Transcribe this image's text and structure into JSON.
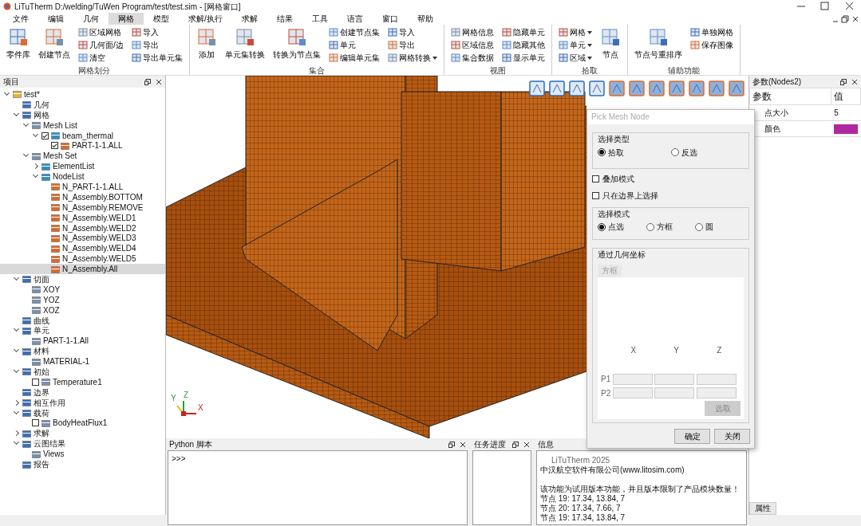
{
  "window": {
    "title": "LiTuTherm D:/welding/TuWen Program/test/test.sim - [网格窗口]"
  },
  "menu": [
    {
      "label": "文件",
      "selected": false
    },
    {
      "label": "编辑",
      "selected": false
    },
    {
      "label": "几何",
      "selected": false
    },
    {
      "label": "网格",
      "selected": true
    },
    {
      "label": "模型",
      "selected": false
    },
    {
      "label": "求解/执行",
      "selected": false
    },
    {
      "label": "求解",
      "selected": false
    },
    {
      "label": "结果",
      "selected": false
    },
    {
      "label": "工具",
      "selected": false
    },
    {
      "label": "语言",
      "selected": false
    },
    {
      "label": "窗口",
      "selected": false
    },
    {
      "label": "帮助",
      "selected": false
    }
  ],
  "ribbon": [
    {
      "label": "网格划分",
      "items": [
        {
          "kind": "large",
          "label": "零件库"
        },
        {
          "kind": "large",
          "label": "创建节点"
        },
        {
          "kind": "column",
          "buttons": [
            {
              "label": "区域网格",
              "dropdown": false
            },
            {
              "label": "几何面/边",
              "dropdown": false
            },
            {
              "label": "清空",
              "dropdown": false
            }
          ]
        },
        {
          "kind": "column",
          "buttons": [
            {
              "label": "导入",
              "dropdown": false
            },
            {
              "label": "导出",
              "dropdown": false
            },
            {
              "label": "导出单元集",
              "dropdown": false
            }
          ]
        }
      ]
    },
    {
      "label": "集合",
      "items": [
        {
          "kind": "large",
          "label": "添加"
        },
        {
          "kind": "large",
          "label": "单元集转换"
        },
        {
          "kind": "large",
          "label": "转换为节点集"
        },
        {
          "kind": "column",
          "buttons": [
            {
              "label": "创建节点集",
              "dropdown": false
            },
            {
              "label": "单元",
              "dropdown": false
            },
            {
              "label": "编辑单元集",
              "dropdown": false
            }
          ]
        },
        {
          "kind": "column",
          "buttons": [
            {
              "label": "导入",
              "dropdown": false
            },
            {
              "label": "导出",
              "dropdown": false
            },
            {
              "label": "网格转换",
              "dropdown": true
            }
          ]
        }
      ]
    },
    {
      "label": "视图",
      "items": [
        {
          "kind": "column",
          "buttons": [
            {
              "label": "网格信息",
              "dropdown": false
            },
            {
              "label": "区域信息",
              "dropdown": false
            },
            {
              "label": "集合数据",
              "dropdown": false
            }
          ]
        },
        {
          "kind": "column",
          "buttons": [
            {
              "label": "隐藏单元",
              "dropdown": false
            },
            {
              "label": "隐藏其他",
              "dropdown": false
            },
            {
              "label": "显示单元",
              "dropdown": false
            }
          ]
        }
      ]
    },
    {
      "label": "拾取",
      "items": [
        {
          "kind": "column",
          "buttons": [
            {
              "label": "网格",
              "dropdown": true
            },
            {
              "label": "单元",
              "dropdown": true
            },
            {
              "label": "区域",
              "dropdown": true
            }
          ]
        },
        {
          "kind": "large",
          "label": "节点"
        }
      ]
    },
    {
      "label": "辅助功能",
      "items": [
        {
          "kind": "large",
          "label": "节点号重排序"
        },
        {
          "kind": "column",
          "buttons": [
            {
              "label": "单独网格",
              "dropdown": false
            },
            {
              "label": "保存图像",
              "dropdown": false
            }
          ]
        }
      ]
    }
  ],
  "project_panel": {
    "title": "项目",
    "tree": [
      {
        "label": "test*",
        "expanded": true,
        "selected": false,
        "children": [
          {
            "label": "几何",
            "selected": false
          },
          {
            "label": "网格",
            "expanded": true,
            "selected": false,
            "children": [
              {
                "label": "Mesh List",
                "expanded": true,
                "selected": false,
                "children": [
                  {
                    "label": "beam_thermal",
                    "expanded": true,
                    "checked": true,
                    "selected": false,
                    "children": [
                      {
                        "label": "PART-1-1.ALL",
                        "checked": true,
                        "selected": false
                      }
                    ]
                  }
                ]
              },
              {
                "label": "Mesh Set",
                "expanded": true,
                "selected": false,
                "children": [
                  {
                    "label": "ElementList",
                    "expanded": false,
                    "selected": false
                  },
                  {
                    "label": "NodeList",
                    "expanded": true,
                    "selected": false,
                    "children": [
                      {
                        "label": "N_PART-1-1.ALL",
                        "selected": false
                      },
                      {
                        "label": "N_Assembly.BOTTOM",
                        "selected": false
                      },
                      {
                        "label": "N_Assembly.REMOVE",
                        "selected": false
                      },
                      {
                        "label": "N_Assembly.WELD1",
                        "selected": false
                      },
                      {
                        "label": "N_Assembly.WELD2",
                        "selected": false
                      },
                      {
                        "label": "N_Assembly.WELD3",
                        "selected": false
                      },
                      {
                        "label": "N_Assembly.WELD4",
                        "selected": false
                      },
                      {
                        "label": "N_Assembly.WELD5",
                        "selected": false
                      },
                      {
                        "label": "N_Assembly.All",
                        "selected": true
                      }
                    ]
                  }
                ]
              }
            ]
          },
          {
            "label": "切面",
            "expanded": true,
            "selected": false,
            "children": [
              {
                "label": "XOY",
                "selected": false
              },
              {
                "label": "YOZ",
                "selected": false
              },
              {
                "label": "XOZ",
                "selected": false
              }
            ]
          },
          {
            "label": "曲线",
            "selected": false
          },
          {
            "label": "单元",
            "expanded": true,
            "selected": false,
            "children": [
              {
                "label": "PART-1-1.All",
                "selected": false
              }
            ]
          },
          {
            "label": "材料",
            "expanded": true,
            "selected": false,
            "children": [
              {
                "label": "MATERIAL-1",
                "selected": false
              }
            ]
          },
          {
            "label": "初始",
            "expanded": true,
            "selected": false,
            "children": [
              {
                "label": "Temperature1",
                "checked": false,
                "selected": false
              }
            ]
          },
          {
            "label": "边界",
            "selected": false
          },
          {
            "label": "相互作用",
            "expanded": false,
            "selected": false
          },
          {
            "label": "载荷",
            "expanded": true,
            "selected": false,
            "children": [
              {
                "label": "BodyHeatFlux1",
                "checked": false,
                "selected": false
              }
            ]
          },
          {
            "label": "求解",
            "expanded": false,
            "selected": false
          },
          {
            "label": "云图结果",
            "expanded": true,
            "selected": false,
            "children": [
              {
                "label": "Views",
                "selected": false
              }
            ]
          },
          {
            "label": "报告",
            "selected": false
          }
        ]
      }
    ]
  },
  "viewport": {
    "axes": [
      "Y",
      "Z",
      "X"
    ]
  },
  "pick_dialog": {
    "title": "Pick Mesh Node",
    "select_type": {
      "label": "选择类型",
      "options": [
        {
          "label": "拾取",
          "selected": true
        },
        {
          "label": "反选",
          "selected": false
        }
      ]
    },
    "checks": [
      {
        "label": "叠加模式",
        "checked": false
      },
      {
        "label": "只在边界上选择",
        "checked": false
      }
    ],
    "select_mode": {
      "label": "选择模式",
      "options": [
        {
          "label": "点选",
          "selected": true
        },
        {
          "label": "方框",
          "selected": false
        },
        {
          "label": "圆",
          "selected": false
        }
      ]
    },
    "coords": {
      "label": "通过几何坐标",
      "tab": "方框",
      "columns": [
        "X",
        "Y",
        "Z"
      ],
      "rows": [
        "P1",
        "P2"
      ],
      "pick_button": {
        "label": "选取",
        "disabled": true
      }
    },
    "buttons": [
      "确定",
      "关闭"
    ]
  },
  "params_panel": {
    "title": "参数(Nodes2)",
    "columns": [
      "参数",
      "值"
    ],
    "rows": [
      {
        "name": "点大小",
        "value": "5"
      },
      {
        "name": "颜色",
        "color": "#b0289f"
      }
    ],
    "tab": "属性"
  },
  "python_panel": {
    "title": "Python 脚本",
    "prompt": ">>>"
  },
  "progress_panel": {
    "title": "任务进度"
  },
  "info_panel": {
    "title": "信息",
    "lines": [
      {
        "kind": "banner",
        "text": "LiTuTherm 2025"
      },
      {
        "kind": "text",
        "text": "中汉航空软件有限公司(www.litosim.com)"
      },
      {
        "kind": "gap",
        "text": "该功能为试用版本功能，并且版本限制了产品模块数量！"
      },
      {
        "kind": "text",
        "text": "节点 19: 17.34, 13.84, 7"
      },
      {
        "kind": "text",
        "text": "节点 20: 17.34, 7.66, 7"
      },
      {
        "kind": "text",
        "text": "节点 19: 17.34, 13.84, 7"
      }
    ]
  }
}
